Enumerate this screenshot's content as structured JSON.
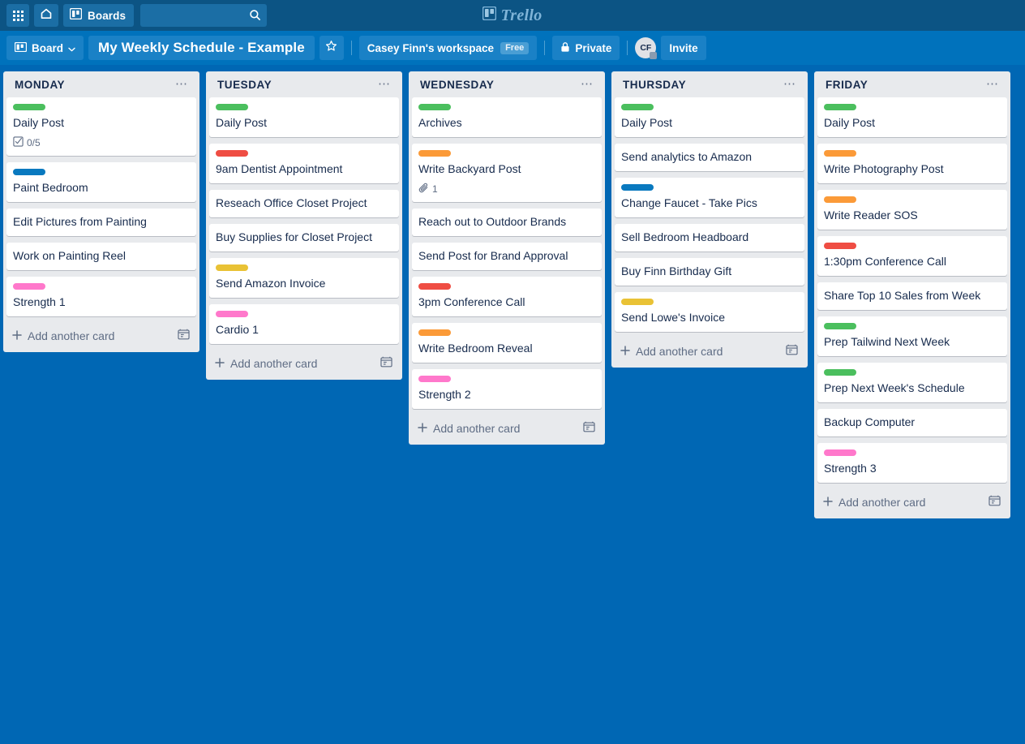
{
  "topnav": {
    "apps_label": "apps-grid",
    "home_label": "home",
    "boards_label": "Boards",
    "search_value": "",
    "search_placeholder": "",
    "brand_name": "Trello"
  },
  "boardbar": {
    "board_button_label": "Board",
    "board_title": "My Weekly Schedule - Example",
    "star_icon": "star-icon",
    "workspace_name": "Casey Finn's workspace",
    "workspace_plan": "Free",
    "visibility_label": "Private",
    "avatar_initials": "CF",
    "invite_label": "Invite"
  },
  "colors": {
    "green": "#4bbf5e",
    "red": "#ef4d43",
    "blue": "#0979bf",
    "yellow": "#e9c235",
    "orange": "#fb9a38",
    "pink": "#ff78cb",
    "board_bg": "#0067b4",
    "list_bg": "#e8eaed",
    "card_bg": "#ffffff",
    "topnav_bg": "#0c5484",
    "boardbar_bg": "#0072bc"
  },
  "add_card_label": "Add another card",
  "lists": [
    {
      "title": "MONDAY",
      "cards": [
        {
          "title": "Daily Post",
          "label": "green",
          "badges": [
            {
              "icon": "checklist-icon",
              "value": "0/5"
            }
          ]
        },
        {
          "title": "Paint Bedroom",
          "label": "blue",
          "badges": []
        },
        {
          "title": "Edit Pictures from Painting",
          "label": null,
          "badges": []
        },
        {
          "title": "Work on Painting Reel",
          "label": null,
          "badges": []
        },
        {
          "title": "Strength 1",
          "label": "pink",
          "badges": []
        }
      ]
    },
    {
      "title": "TUESDAY",
      "cards": [
        {
          "title": "Daily Post",
          "label": "green",
          "badges": []
        },
        {
          "title": "9am Dentist Appointment",
          "label": "red",
          "badges": []
        },
        {
          "title": "Reseach Office Closet Project",
          "label": null,
          "badges": []
        },
        {
          "title": "Buy Supplies for Closet Project",
          "label": null,
          "badges": []
        },
        {
          "title": "Send Amazon Invoice",
          "label": "yellow",
          "badges": []
        },
        {
          "title": "Cardio 1",
          "label": "pink",
          "badges": []
        }
      ]
    },
    {
      "title": "WEDNESDAY",
      "cards": [
        {
          "title": "Archives",
          "label": "green",
          "badges": []
        },
        {
          "title": "Write Backyard Post",
          "label": "orange",
          "badges": [
            {
              "icon": "attachment-icon",
              "value": "1"
            }
          ]
        },
        {
          "title": "Reach out to Outdoor Brands",
          "label": null,
          "badges": []
        },
        {
          "title": "Send Post for Brand Approval",
          "label": null,
          "badges": []
        },
        {
          "title": "3pm Conference Call",
          "label": "red",
          "badges": []
        },
        {
          "title": "Write Bedroom Reveal",
          "label": "orange",
          "badges": []
        },
        {
          "title": "Strength 2",
          "label": "pink",
          "badges": []
        }
      ]
    },
    {
      "title": "THURSDAY",
      "cards": [
        {
          "title": "Daily Post",
          "label": "green",
          "badges": []
        },
        {
          "title": "Send analytics to Amazon",
          "label": null,
          "badges": []
        },
        {
          "title": "Change Faucet - Take Pics",
          "label": "blue",
          "badges": []
        },
        {
          "title": "Sell Bedroom Headboard",
          "label": null,
          "badges": []
        },
        {
          "title": "Buy Finn Birthday Gift",
          "label": null,
          "badges": []
        },
        {
          "title": "Send Lowe's Invoice",
          "label": "yellow",
          "badges": []
        }
      ]
    },
    {
      "title": "FRIDAY",
      "cards": [
        {
          "title": "Daily Post",
          "label": "green",
          "badges": []
        },
        {
          "title": "Write Photography Post",
          "label": "orange",
          "badges": []
        },
        {
          "title": "Write Reader SOS",
          "label": "orange",
          "badges": []
        },
        {
          "title": "1:30pm Conference Call",
          "label": "red",
          "badges": []
        },
        {
          "title": "Share Top 10 Sales from Week",
          "label": null,
          "badges": []
        },
        {
          "title": "Prep Tailwind Next Week",
          "label": "green",
          "badges": []
        },
        {
          "title": "Prep Next Week's Schedule",
          "label": "green",
          "badges": []
        },
        {
          "title": "Backup Computer",
          "label": null,
          "badges": []
        },
        {
          "title": "Strength 3",
          "label": "pink",
          "badges": []
        }
      ]
    }
  ]
}
